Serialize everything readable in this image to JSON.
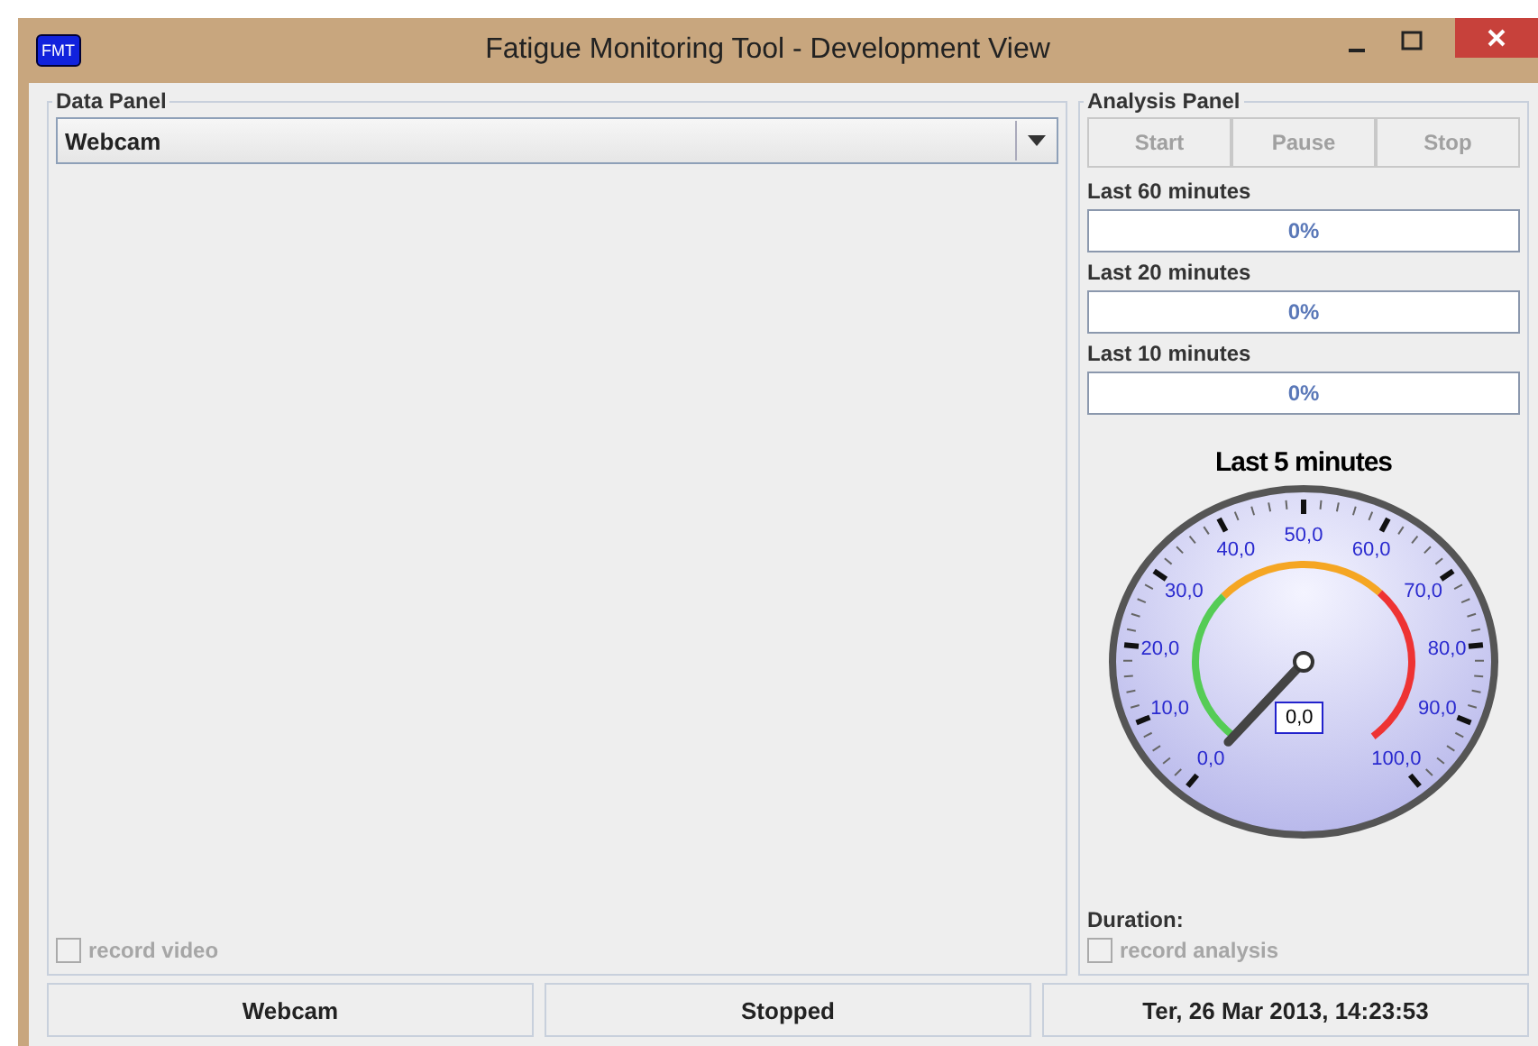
{
  "window": {
    "title": "Fatigue Monitoring Tool - Development View",
    "logo": "FMT"
  },
  "data_panel": {
    "title": "Data Panel",
    "source": "Webcam",
    "record": {
      "label": "record video",
      "checked": false,
      "disabled": true
    }
  },
  "analysis_panel": {
    "title": "Analysis Panel",
    "buttons": [
      {
        "label": "Start",
        "disabled": true
      },
      {
        "label": "Pause",
        "disabled": true
      },
      {
        "label": "Stop",
        "disabled": true
      }
    ],
    "meters": [
      {
        "label": "Last 60 minutes",
        "level": 0,
        "reading": "0%"
      },
      {
        "label": "Last 20 minutes",
        "level": 0,
        "reading": "0%"
      },
      {
        "label": "Last 10 minutes",
        "level": 0,
        "reading": "0%"
      }
    ],
    "gauge": {
      "title": "Last 5 minutes",
      "reading": "0,0",
      "ticks": [
        "0,0",
        "10,0",
        "20,0",
        "30,0",
        "40,0",
        "50,0",
        "60,0",
        "70,0",
        "80,0",
        "90,0",
        "100,0"
      ]
    },
    "duration_label": "Duration:",
    "record": {
      "label": "record analysis",
      "checked": false,
      "disabled": true
    }
  },
  "status_bar": [
    "Webcam",
    "Stopped",
    "Ter, 26 Mar 2013, 14:23:53"
  ]
}
